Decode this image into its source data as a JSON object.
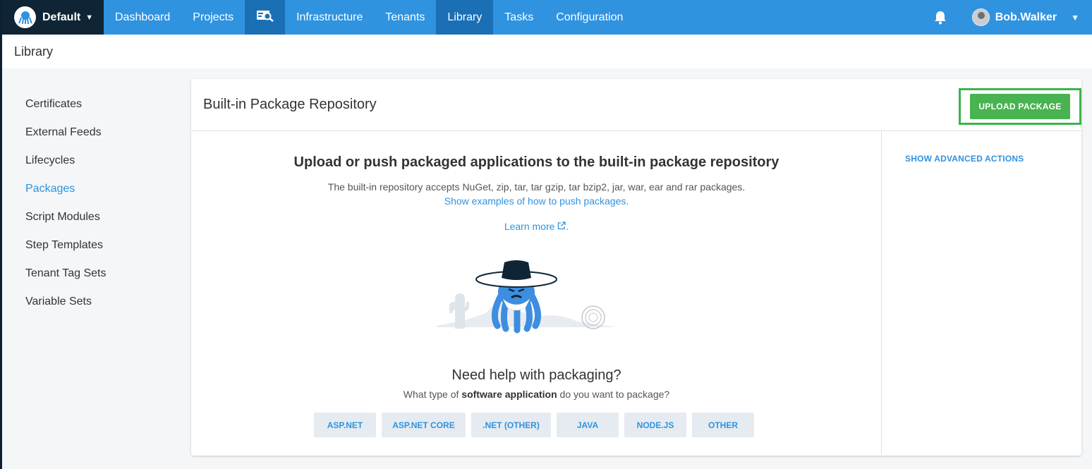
{
  "topnav": {
    "space": "Default",
    "items": [
      {
        "label": "Dashboard"
      },
      {
        "label": "Projects"
      },
      {
        "label": ""
      },
      {
        "label": "Infrastructure"
      },
      {
        "label": "Tenants"
      },
      {
        "label": "Library"
      },
      {
        "label": "Tasks"
      },
      {
        "label": "Configuration"
      }
    ],
    "user": "Bob.Walker"
  },
  "page": {
    "title": "Library"
  },
  "sidebar": {
    "items": [
      {
        "label": "Certificates"
      },
      {
        "label": "External Feeds"
      },
      {
        "label": "Lifecycles"
      },
      {
        "label": "Packages"
      },
      {
        "label": "Script Modules"
      },
      {
        "label": "Step Templates"
      },
      {
        "label": "Tenant Tag Sets"
      },
      {
        "label": "Variable Sets"
      }
    ]
  },
  "card": {
    "title": "Built-in Package Repository",
    "upload_label": "UPLOAD PACKAGE",
    "advanced_label": "SHOW ADVANCED ACTIONS",
    "hero_title": "Upload or push packaged applications to the built-in package repository",
    "hero_sub": "The built-in repository accepts NuGet, zip, tar, tar gzip, tar bzip2, jar, war, ear and rar packages.",
    "hero_link": "Show examples of how to push packages",
    "learn_more": "Learn more",
    "help_title": "Need help with packaging?",
    "help_sub_pre": "What type of ",
    "help_sub_bold": "software application",
    "help_sub_post": " do you want to package?",
    "pkg_types": [
      {
        "label": "ASP.NET"
      },
      {
        "label": "ASP.NET CORE"
      },
      {
        "label": ".NET (OTHER)"
      },
      {
        "label": "JAVA"
      },
      {
        "label": "NODE.JS"
      },
      {
        "label": "OTHER"
      }
    ]
  },
  "colors": {
    "nav": "#2f93e0",
    "nav_active": "#1a6fb5",
    "space_switcher": "#0f2535",
    "upload_green": "#48b350",
    "highlight_border": "#3bb54a",
    "link_blue": "#2f93e0"
  },
  "icons": {
    "logo": "octopus-logo-icon",
    "search": "search-icon",
    "bell": "bell-icon",
    "external": "external-link-icon"
  }
}
